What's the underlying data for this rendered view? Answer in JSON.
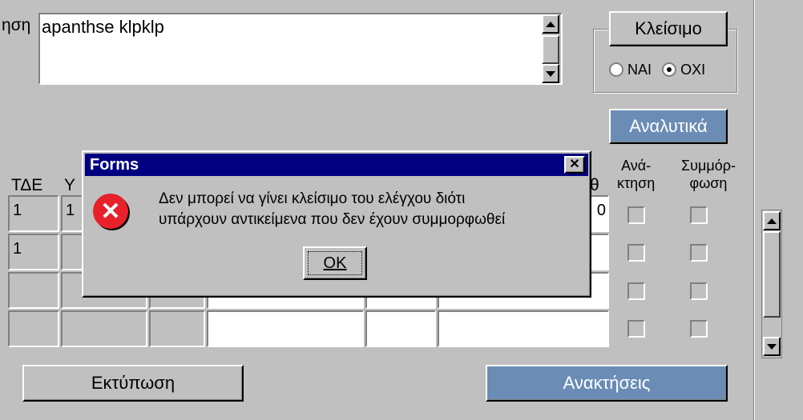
{
  "top_field": {
    "label_fragment": "ηση",
    "value": "apanthse klpklp"
  },
  "closing_group": {
    "button_label": "Κλείσιμο",
    "option_yes": "ΝΑΙ",
    "option_no": "ΟΧΙ",
    "selected": "ΟΧΙ"
  },
  "analytics_button": "Αναλυτικά",
  "table": {
    "headers": {
      "tde": "ΤΔΕ",
      "y_fragment": "Υ",
      "th_fragment": "θ",
      "recovery": "Ανά-\nκτηση",
      "compliance": "Συμμόρ-\nφωση"
    },
    "rows": [
      {
        "tde": "1",
        "y": "1",
        "th": "0"
      },
      {
        "tde": "1",
        "y": "",
        "th": ""
      },
      {
        "tde": "",
        "y": "",
        "th": ""
      },
      {
        "tde": "",
        "y": "",
        "th": ""
      }
    ]
  },
  "print_button": "Εκτύπωση",
  "recoveries_button": "Ανακτήσεις",
  "dialog": {
    "title": "Forms",
    "close_glyph": "✕",
    "message_line1": "Δεν μπορεί να γίνει κλείσιμο του ελέγχου διότι",
    "message_line2": "υπάρχουν αντικείμενα που δεν έχουν συμμορφωθεί",
    "ok_label": "OK",
    "error_glyph": "✕"
  },
  "colors": {
    "face": "#c0c0c0",
    "title_bar": "#000080",
    "accent_button": "#6b8db5",
    "error_red": "#e8202a"
  }
}
